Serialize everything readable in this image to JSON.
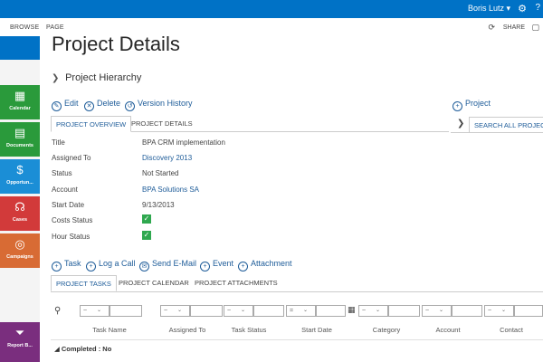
{
  "topbar": {
    "user": "Boris Lutz ▾",
    "gear_icon": "gear-icon",
    "help_icon": "question-icon"
  },
  "ribbon": {
    "browse": "BROWSE",
    "page": "PAGE",
    "share": "SHARE"
  },
  "nav_tiles": [
    {
      "label": "Calendar",
      "icon": "calendar-icon",
      "color": "#2a9a3b"
    },
    {
      "label": "Documents",
      "icon": "documents-icon",
      "color": "#2a9a3b"
    },
    {
      "label": "Opportun...",
      "icon": "dollar-icon",
      "color": "#1b8ed6"
    },
    {
      "label": "Cases",
      "icon": "headset-icon",
      "color": "#d23a3a"
    },
    {
      "label": "Campaigns",
      "icon": "target-icon",
      "color": "#d86b34"
    },
    {
      "label": "Report B...",
      "icon": "filter-icon",
      "color": "#7a2e7e"
    }
  ],
  "page": {
    "title": "Project Details",
    "hierarchy": "Project Hierarchy"
  },
  "commands": {
    "edit": "Edit",
    "delete": "Delete",
    "version_history": "Version History",
    "add_project": "Project"
  },
  "tabs": {
    "overview": "PROJECT OVERVIEW",
    "details": "PROJECT DETAILS",
    "search_all": "SEARCH ALL PROJECTS"
  },
  "fields": {
    "title": {
      "label": "Title",
      "value": "BPA CRM implementation"
    },
    "assigned_to": {
      "label": "Assigned To",
      "value": "Discovery 2013"
    },
    "status": {
      "label": "Status",
      "value": "Not Started"
    },
    "account": {
      "label": "Account",
      "value": "BPA Solutions SA"
    },
    "start_date": {
      "label": "Start Date",
      "value": "9/13/2013"
    },
    "costs_status": {
      "label": "Costs Status"
    },
    "hour_status": {
      "label": "Hour Status"
    }
  },
  "actions": {
    "task": "Task",
    "log_call": "Log a Call",
    "send_email": "Send E-Mail",
    "event": "Event",
    "attachment": "Attachment"
  },
  "subtabs": {
    "tasks": "PROJECT TASKS",
    "calendar": "PROJECT CALENDAR",
    "attachments": "PROJECT ATTACHMENTS"
  },
  "filters": {
    "op_tilde": "~",
    "op_eq": "=",
    "caret": "⌄"
  },
  "columns": [
    "Task Name",
    "Assigned To",
    "Task Status",
    "Start Date",
    "Category",
    "Account",
    "Contact"
  ],
  "group": {
    "label": "Completed : No"
  }
}
